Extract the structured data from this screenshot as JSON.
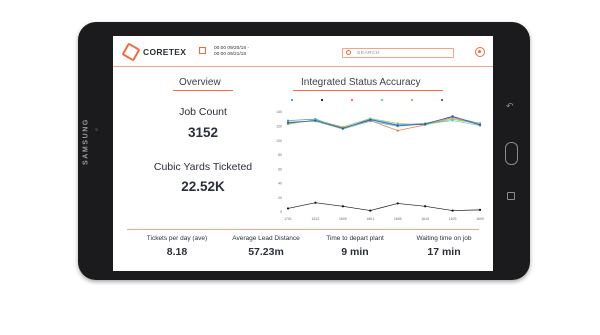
{
  "device": {
    "brand": "SAMSUNG"
  },
  "header": {
    "logo_text": "CORETEX",
    "date_start": "00:00 09/20/18 -",
    "date_end": "00:00 09/21/18",
    "search_placeholder": "SEARCH"
  },
  "overview": {
    "title": "Overview",
    "job_count_label": "Job Count",
    "job_count_value": "3152",
    "cubic_yards_label": "Cubic Yards Ticketed",
    "cubic_yards_value": "22.52K"
  },
  "accuracy": {
    "title": "Integrated Status Accuracy"
  },
  "stats": [
    {
      "label": "Tickets per day (ave)",
      "value": "8.18"
    },
    {
      "label": "Average Lead Distance",
      "value": "57.23m"
    },
    {
      "label": "Time to depart plant",
      "value": "9 min"
    },
    {
      "label": "Waiting time on job",
      "value": "17 min"
    }
  ],
  "colors": {
    "accent": "#f26b3a",
    "text": "#2a2f3a"
  },
  "chart_data": {
    "type": "line",
    "x": [
      "1701",
      "1613",
      "1609",
      "1601",
      "1605",
      "1610",
      "1623",
      "1609"
    ],
    "yticks": [
      0,
      20,
      40,
      60,
      80,
      100,
      120,
      140
    ],
    "ylim": [
      0,
      140
    ],
    "legend_position": "top",
    "series": [
      {
        "name": "",
        "color": "#3b8fd9",
        "values": [
          128,
          130,
          117,
          130,
          122,
          124,
          133,
          124
        ]
      },
      {
        "name": "",
        "color": "#111111",
        "values": [
          5,
          13,
          8,
          2,
          12,
          8,
          2,
          3
        ]
      },
      {
        "name": "",
        "color": "#f26b3a",
        "values": [
          124,
          128,
          118,
          128,
          114,
          122,
          132,
          122
        ]
      },
      {
        "name": "",
        "color": "#5cc7c0",
        "values": [
          126,
          127,
          116,
          127,
          120,
          123,
          128,
          121
        ]
      },
      {
        "name": "",
        "color": "#7ac96b",
        "values": [
          123,
          129,
          119,
          131,
          124,
          122,
          130,
          123
        ]
      },
      {
        "name": "",
        "color": "#4b4fa8",
        "values": [
          125,
          128,
          117,
          129,
          121,
          123,
          134,
          122
        ]
      }
    ]
  }
}
